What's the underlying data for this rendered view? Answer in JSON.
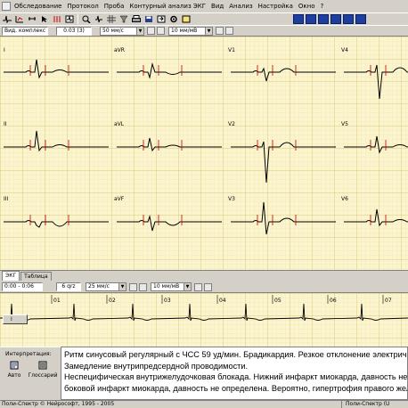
{
  "menu": [
    {
      "label": "Обследование"
    },
    {
      "label": "Протокол"
    },
    {
      "label": "Проба"
    },
    {
      "label": "Контурный анализ ЭКГ"
    },
    {
      "label": "Вид"
    },
    {
      "label": "Анализ"
    },
    {
      "label": "Настройка"
    },
    {
      "label": "Окно"
    },
    {
      "label": "?"
    }
  ],
  "params": {
    "complex_label": "Вид. комплекс",
    "time_value": "0.03 (3)",
    "speed": "50 мм/с",
    "gain": "10 мм/мВ"
  },
  "leads": {
    "col1": [
      "I",
      "II",
      "III"
    ],
    "col2": [
      "aVR",
      "aVL",
      "aVF"
    ],
    "col3": [
      "V1",
      "V2",
      "V3"
    ],
    "col4": [
      "V4",
      "V5",
      "V6"
    ]
  },
  "tabs": [
    "ЭКГ",
    "Таблица"
  ],
  "rhythm": {
    "time_range": "0:00 - 0:06",
    "paper": "6 qrz",
    "speed": "25 мм/с",
    "gain": "10 мм/мВ",
    "lead_button": "I",
    "ticks": [
      "01",
      "02",
      "03",
      "04",
      "05",
      "06",
      "07"
    ]
  },
  "interpretation": {
    "title": "Интерпретация:",
    "auto_label": "Авто",
    "glossary_label": "Глоссарий",
    "lines": [
      "Ритм синусовый регулярный с ЧСС 59 уд/мин. Брадикардия. Резкое отклонение электрической оси сердца",
      "Замедление внутрипредсердной проводимости.",
      "Неспецифическая внутрижелудочковая блокада. Нижний инфаркт миокарда, давность не определена.",
      "боковой инфаркт миокарда, давность не определена. Вероятно, гипертрофия правого желудочка"
    ]
  },
  "status": {
    "left": "Поли-Спектр © Нейрософт, 1995 - 2005",
    "right": "Поли-Спектр (U"
  },
  "colors": {
    "grid_bg": "#fbf5cf",
    "grid_minor": "#efdf9c",
    "grid_major": "#d7bd63",
    "trace": "#000000",
    "marker": "#c00000"
  }
}
